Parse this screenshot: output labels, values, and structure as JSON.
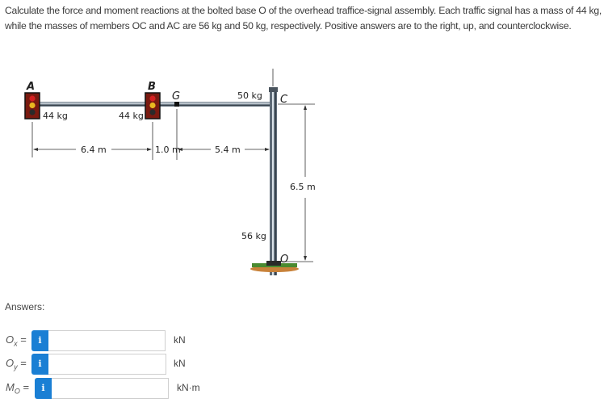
{
  "problem": {
    "text": "Calculate the force and moment reactions at the bolted base O of the overhead traffice-signal assembly. Each traffic signal has a mass of 44 kg, while the masses of members OC and AC are 56 kg and 50 kg, respectively. Positive answers are to the right, up, and counterclockwise."
  },
  "diagram": {
    "point_labels": {
      "A": "A",
      "B": "B",
      "G": "G",
      "C": "C",
      "O": "O"
    },
    "mass_labels": {
      "signal_A": "44 kg",
      "signal_B": "44 kg",
      "arm_AC": "50 kg",
      "pole_OC": "56 kg"
    },
    "dimensions": {
      "AB": "6.4 m",
      "BG": "1.0 m",
      "GC": "5.4 m",
      "OC_height": "6.5 m"
    },
    "colors": {
      "signal_red": "#d42020",
      "signal_yellow": "#e8b820",
      "signal_off": "#2a2a2a",
      "signal_housing": "#7a1a10",
      "ground_green": "#4a8a30",
      "ground_soil": "#c8823a"
    }
  },
  "answers": {
    "heading": "Answers:",
    "rows": [
      {
        "symbol": "O",
        "subscript": "x",
        "equals": "=",
        "info": "i",
        "value": "",
        "unit": "kN"
      },
      {
        "symbol": "O",
        "subscript": "y",
        "equals": "=",
        "info": "i",
        "value": "",
        "unit": "kN"
      },
      {
        "symbol": "M",
        "subscript": "O",
        "equals": "=",
        "info": "i",
        "value": "",
        "unit": "kN·m"
      }
    ]
  },
  "colors": {
    "info_button": "#1a7fd4",
    "input_border": "#cfcfcf"
  }
}
